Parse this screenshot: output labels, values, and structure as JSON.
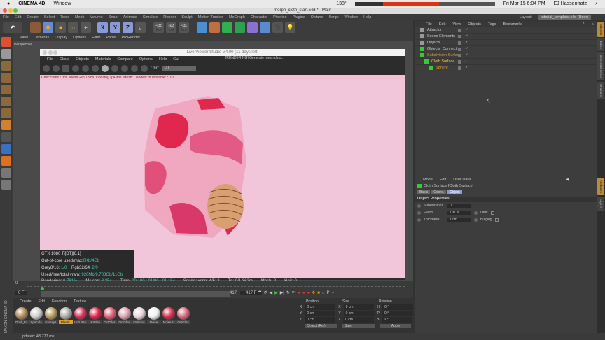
{
  "mac_menubar": {
    "app": "CINEMA 4D",
    "window": "Window",
    "temp": "138°",
    "datetime": "Fri Mar 15  6:04 PM",
    "user": "EJ Hassenfratz"
  },
  "window_title": "morph_cloth_start.c4d * - Main",
  "main_menu": [
    "File",
    "Edit",
    "Create",
    "Select",
    "Tools",
    "Mesh",
    "Volume",
    "Snap",
    "Animate",
    "Simulate",
    "Render",
    "Sculpt",
    "Motion Tracker",
    "MoGraph",
    "Character",
    "Pipeline",
    "Plugins",
    "Octane",
    "Script",
    "Window",
    "Help"
  ],
  "layout": {
    "label": "Layout:",
    "value": "tutorial_template.c4d (User)"
  },
  "toolbar": {
    "axes": [
      "X",
      "Y",
      "Z"
    ]
  },
  "viewport": {
    "menu": [
      "View",
      "Cameras",
      "Display",
      "Options",
      "Filter",
      "Panel",
      "ProRender"
    ],
    "label": "Perspective"
  },
  "live_viewer": {
    "title": "Live Viewer Studio V4.00 (11 days left)",
    "menu": [
      "File",
      "Cloud",
      "Objects",
      "Materials",
      "Compare",
      "Options",
      "Help",
      "Gui"
    ],
    "status": "[RENDERING] Generate mesh data...",
    "chn_label": "Chn:",
    "chn_value": "PT",
    "stats_line": "Check:0ms./1ms. MeshGen:13ms. Update[O]:43ms. Mesh:1 Nodes:28 Movable:2  0 0",
    "info": [
      {
        "label": "GTX 1080 Ti[DT][6.1]",
        "value": ""
      },
      {
        "label": "Out-of-core used/max:",
        "value": "0Kb/4Gb"
      },
      {
        "label": "Grey8/16: ",
        "value": "1/0",
        "label2": "Rgb32/64: ",
        "value2": "2/0"
      },
      {
        "label": "Used/free/total vram: ",
        "value": "926Mb/9.708Gb/11Gb"
      }
    ],
    "bottom": {
      "rendering_label": "Rendering:",
      "rendering": "0.781%",
      "ms_label": "Ms/sec:",
      "ms": "3.354",
      "time_label": "Time:",
      "time": "00 : 00 : 01/00 : 01 : 54",
      "spp_label": "Spp/maxspp:",
      "spp": "4/512",
      "tri_label": "Tri:",
      "tri": "0/1.362m",
      "mesh_label": "Mesh:",
      "mesh": "2",
      "hair_label": "Hair:",
      "hair": "0"
    }
  },
  "timeline": {
    "start": "0",
    "current": "0 F",
    "end_a": "417",
    "end_b": "417 F"
  },
  "material_manager": {
    "menu": [
      "Create",
      "Edit",
      "Function",
      "Texture"
    ],
    "materials": [
      {
        "name": "Gold_Fo",
        "color": "#b08a5a"
      },
      {
        "name": "Specula",
        "color": "#cfcfcf"
      },
      {
        "name": "Glossy1",
        "color": "#b59a5e"
      },
      {
        "name": "Plastic",
        "color": "#aaaaaa",
        "selected": true
      },
      {
        "name": "Unit Pan",
        "color": "#d8335a"
      },
      {
        "name": "Hot Pin",
        "color": "#e0284e"
      },
      {
        "name": "OctGlos",
        "color": "#e0607a"
      },
      {
        "name": "OctGlos",
        "color": "#e2a0b4"
      },
      {
        "name": "OctGlos",
        "color": "#e8d6dc"
      },
      {
        "name": "Noise",
        "color": "#f0f0f0"
      },
      {
        "name": "Noise.1",
        "color": "#d83050"
      },
      {
        "name": "OctGlos",
        "color": "#d86a80"
      }
    ]
  },
  "coordinates": {
    "headers": [
      "Position",
      "Size",
      "Rotation"
    ],
    "rows": [
      {
        "axis": "X",
        "pos": "0 cm",
        "size_axis": "X",
        "size": "0 cm",
        "rot_axis": "H",
        "rot": "0 °"
      },
      {
        "axis": "Y",
        "pos": "0 cm",
        "size_axis": "Y",
        "size": "0 cm",
        "rot_axis": "P",
        "rot": "0 °"
      },
      {
        "axis": "Z",
        "pos": "0 cm",
        "size_axis": "Z",
        "size": "0 cm",
        "rot_axis": "B",
        "rot": "0 °"
      }
    ],
    "mode": "Object (Rel)",
    "size_mode": "Size",
    "apply": "Apply"
  },
  "status_bar": "Updated: 43.777 ms",
  "object_manager": {
    "menu": [
      "File",
      "Edit",
      "View",
      "Objects",
      "Tags",
      "Bookmarks"
    ],
    "objects": [
      {
        "name": "Attractor",
        "indent": 0,
        "color": "#c8c8c8"
      },
      {
        "name": "Scene Elements",
        "indent": 0,
        "color": "#c8c8c8"
      },
      {
        "name": "Objects",
        "indent": 0,
        "color": "#c8c8c8"
      },
      {
        "name": "Objects_Connect",
        "indent": 0,
        "color": "#c8c8c8"
      },
      {
        "name": "Subdivision Surface",
        "indent": 0,
        "color": "#d69a2a"
      },
      {
        "name": "Cloth Surface",
        "indent": 1,
        "color": "#f0c040"
      },
      {
        "name": "Sphere",
        "indent": 2,
        "color": "#d69a2a"
      }
    ]
  },
  "attribute_manager": {
    "menu": [
      "Mode",
      "Edit",
      "User Data"
    ],
    "title": "Cloth Surface [Cloth Surface]",
    "tabs": [
      "Basic",
      "Coord.",
      "Object"
    ],
    "active_tab": "Object",
    "section": "Object Properties",
    "fields": [
      {
        "label": "Subdivisions",
        "value": "0"
      },
      {
        "label": "Factor",
        "value": "100 %",
        "check": "Limit"
      },
      {
        "label": "Thickness",
        "value": "1 cm",
        "check": "Bulging"
      }
    ]
  },
  "right_tabs": [
    "Objects",
    "Takes",
    "Content Browser",
    "Structure",
    "Attributes",
    "Layers"
  ],
  "brand": "MAXON CINEMA 4D"
}
